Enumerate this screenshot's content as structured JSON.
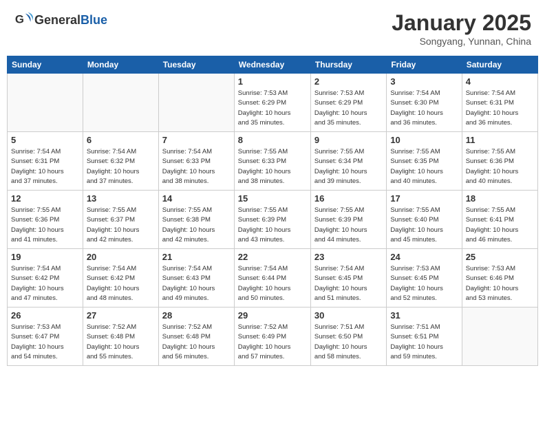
{
  "header": {
    "logo": {
      "general": "General",
      "blue": "Blue"
    },
    "month": "January 2025",
    "location": "Songyang, Yunnan, China"
  },
  "weekdays": [
    "Sunday",
    "Monday",
    "Tuesday",
    "Wednesday",
    "Thursday",
    "Friday",
    "Saturday"
  ],
  "weeks": [
    [
      {
        "day": "",
        "info": ""
      },
      {
        "day": "",
        "info": ""
      },
      {
        "day": "",
        "info": ""
      },
      {
        "day": "1",
        "info": "Sunrise: 7:53 AM\nSunset: 6:29 PM\nDaylight: 10 hours\nand 35 minutes."
      },
      {
        "day": "2",
        "info": "Sunrise: 7:53 AM\nSunset: 6:29 PM\nDaylight: 10 hours\nand 35 minutes."
      },
      {
        "day": "3",
        "info": "Sunrise: 7:54 AM\nSunset: 6:30 PM\nDaylight: 10 hours\nand 36 minutes."
      },
      {
        "day": "4",
        "info": "Sunrise: 7:54 AM\nSunset: 6:31 PM\nDaylight: 10 hours\nand 36 minutes."
      }
    ],
    [
      {
        "day": "5",
        "info": "Sunrise: 7:54 AM\nSunset: 6:31 PM\nDaylight: 10 hours\nand 37 minutes."
      },
      {
        "day": "6",
        "info": "Sunrise: 7:54 AM\nSunset: 6:32 PM\nDaylight: 10 hours\nand 37 minutes."
      },
      {
        "day": "7",
        "info": "Sunrise: 7:54 AM\nSunset: 6:33 PM\nDaylight: 10 hours\nand 38 minutes."
      },
      {
        "day": "8",
        "info": "Sunrise: 7:55 AM\nSunset: 6:33 PM\nDaylight: 10 hours\nand 38 minutes."
      },
      {
        "day": "9",
        "info": "Sunrise: 7:55 AM\nSunset: 6:34 PM\nDaylight: 10 hours\nand 39 minutes."
      },
      {
        "day": "10",
        "info": "Sunrise: 7:55 AM\nSunset: 6:35 PM\nDaylight: 10 hours\nand 40 minutes."
      },
      {
        "day": "11",
        "info": "Sunrise: 7:55 AM\nSunset: 6:36 PM\nDaylight: 10 hours\nand 40 minutes."
      }
    ],
    [
      {
        "day": "12",
        "info": "Sunrise: 7:55 AM\nSunset: 6:36 PM\nDaylight: 10 hours\nand 41 minutes."
      },
      {
        "day": "13",
        "info": "Sunrise: 7:55 AM\nSunset: 6:37 PM\nDaylight: 10 hours\nand 42 minutes."
      },
      {
        "day": "14",
        "info": "Sunrise: 7:55 AM\nSunset: 6:38 PM\nDaylight: 10 hours\nand 42 minutes."
      },
      {
        "day": "15",
        "info": "Sunrise: 7:55 AM\nSunset: 6:39 PM\nDaylight: 10 hours\nand 43 minutes."
      },
      {
        "day": "16",
        "info": "Sunrise: 7:55 AM\nSunset: 6:39 PM\nDaylight: 10 hours\nand 44 minutes."
      },
      {
        "day": "17",
        "info": "Sunrise: 7:55 AM\nSunset: 6:40 PM\nDaylight: 10 hours\nand 45 minutes."
      },
      {
        "day": "18",
        "info": "Sunrise: 7:55 AM\nSunset: 6:41 PM\nDaylight: 10 hours\nand 46 minutes."
      }
    ],
    [
      {
        "day": "19",
        "info": "Sunrise: 7:54 AM\nSunset: 6:42 PM\nDaylight: 10 hours\nand 47 minutes."
      },
      {
        "day": "20",
        "info": "Sunrise: 7:54 AM\nSunset: 6:42 PM\nDaylight: 10 hours\nand 48 minutes."
      },
      {
        "day": "21",
        "info": "Sunrise: 7:54 AM\nSunset: 6:43 PM\nDaylight: 10 hours\nand 49 minutes."
      },
      {
        "day": "22",
        "info": "Sunrise: 7:54 AM\nSunset: 6:44 PM\nDaylight: 10 hours\nand 50 minutes."
      },
      {
        "day": "23",
        "info": "Sunrise: 7:54 AM\nSunset: 6:45 PM\nDaylight: 10 hours\nand 51 minutes."
      },
      {
        "day": "24",
        "info": "Sunrise: 7:53 AM\nSunset: 6:45 PM\nDaylight: 10 hours\nand 52 minutes."
      },
      {
        "day": "25",
        "info": "Sunrise: 7:53 AM\nSunset: 6:46 PM\nDaylight: 10 hours\nand 53 minutes."
      }
    ],
    [
      {
        "day": "26",
        "info": "Sunrise: 7:53 AM\nSunset: 6:47 PM\nDaylight: 10 hours\nand 54 minutes."
      },
      {
        "day": "27",
        "info": "Sunrise: 7:52 AM\nSunset: 6:48 PM\nDaylight: 10 hours\nand 55 minutes."
      },
      {
        "day": "28",
        "info": "Sunrise: 7:52 AM\nSunset: 6:48 PM\nDaylight: 10 hours\nand 56 minutes."
      },
      {
        "day": "29",
        "info": "Sunrise: 7:52 AM\nSunset: 6:49 PM\nDaylight: 10 hours\nand 57 minutes."
      },
      {
        "day": "30",
        "info": "Sunrise: 7:51 AM\nSunset: 6:50 PM\nDaylight: 10 hours\nand 58 minutes."
      },
      {
        "day": "31",
        "info": "Sunrise: 7:51 AM\nSunset: 6:51 PM\nDaylight: 10 hours\nand 59 minutes."
      },
      {
        "day": "",
        "info": ""
      }
    ]
  ]
}
